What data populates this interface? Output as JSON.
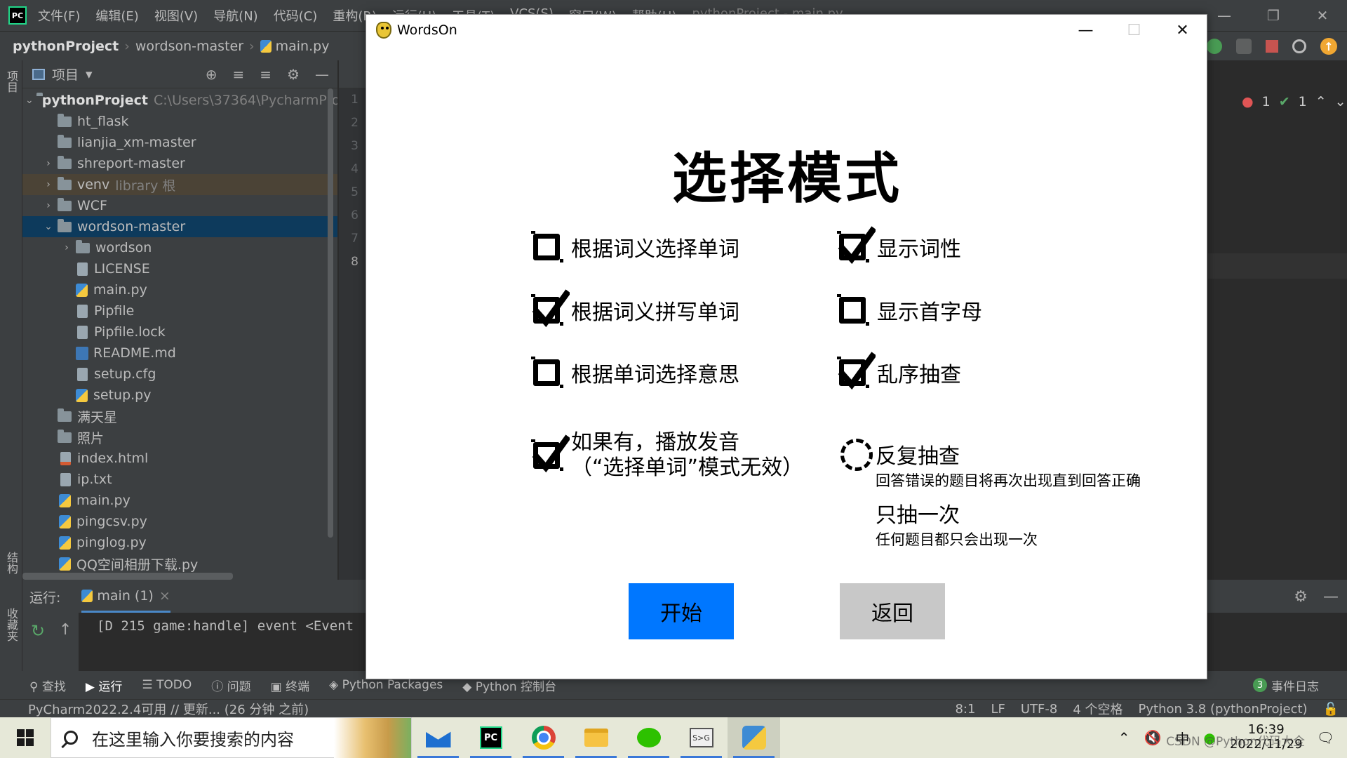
{
  "ide": {
    "logo": "PC",
    "menu": [
      "文件(F)",
      "编辑(E)",
      "视图(V)",
      "导航(N)",
      "代码(C)",
      "重构(R)",
      "运行(U)",
      "工具(T)",
      "VCS(S)",
      "窗口(W)",
      "帮助(H)",
      "pythonProject - main.py"
    ],
    "breadcrumb": [
      "pythonProject",
      "wordson-master",
      "main.py"
    ],
    "left_stripe": {
      "project": "项目",
      "structure": "结构",
      "favorites": "收藏夹"
    },
    "project_panel": {
      "title": "项目",
      "root_name": "pythonProject",
      "root_path": "C:\\Users\\37364\\PycharmProj",
      "items": [
        {
          "label": "ht_flask",
          "type": "folder"
        },
        {
          "label": "lianjia_xm-master",
          "type": "folder"
        },
        {
          "label": "shreport-master",
          "type": "folder"
        },
        {
          "label": "venv",
          "type": "folder",
          "extra": "library 根"
        },
        {
          "label": "WCF",
          "type": "folder"
        },
        {
          "label": "wordson-master",
          "type": "folder"
        },
        {
          "label": "wordson",
          "type": "folder"
        },
        {
          "label": "LICENSE",
          "type": "file"
        },
        {
          "label": "main.py",
          "type": "python"
        },
        {
          "label": "Pipfile",
          "type": "file"
        },
        {
          "label": "Pipfile.lock",
          "type": "file"
        },
        {
          "label": "README.md",
          "type": "markdown"
        },
        {
          "label": "setup.cfg",
          "type": "file"
        },
        {
          "label": "setup.py",
          "type": "python"
        },
        {
          "label": "满天星",
          "type": "folder"
        },
        {
          "label": "照片",
          "type": "folder"
        },
        {
          "label": "index.html",
          "type": "html"
        },
        {
          "label": "ip.txt",
          "type": "file"
        },
        {
          "label": "main.py",
          "type": "python"
        },
        {
          "label": "pingcsv.py",
          "type": "python"
        },
        {
          "label": "pinglog.py",
          "type": "python"
        },
        {
          "label": "QQ空间相册下载.py",
          "type": "python"
        }
      ]
    },
    "line_numbers": [
      "1",
      "2",
      "3",
      "4",
      "5",
      "6",
      "7",
      "8"
    ],
    "inspection": {
      "errors": "1",
      "warnings": "1"
    },
    "run_panel": {
      "label": "运行:",
      "tab": "main (1)",
      "console": "[D 215 game:handle] event <Event"
    },
    "tool_tabs": [
      "查找",
      "运行",
      "TODO",
      "问题",
      "终端",
      "Python Packages",
      "Python 控制台"
    ],
    "event_log": {
      "count": "3",
      "label": "事件日志"
    },
    "status": {
      "message": "PyCharm2022.2.4可用 // 更新... (26 分钟 之前)",
      "position": "8:1",
      "line_sep": "LF",
      "encoding": "UTF-8",
      "indent": "4 个空格",
      "interpreter": "Python 3.8 (pythonProject)"
    }
  },
  "game_window": {
    "title": "WordsOn",
    "heading": "选择模式",
    "options": [
      {
        "label": "根据词义选择单词",
        "checked": false
      },
      {
        "label": "根据词义拼写单词",
        "checked": true
      },
      {
        "label": "根据单词选择意思",
        "checked": false
      },
      {
        "label_line1": "如果有，播放发音",
        "label_line2": "（“选择单词”模式无效）",
        "checked": true
      },
      {
        "label": "显示词性",
        "checked": true
      },
      {
        "label": "显示首字母",
        "checked": false
      },
      {
        "label": "乱序抽查",
        "checked": true
      }
    ],
    "radios": [
      {
        "title": "反复抽查",
        "sub": "回答错误的题目将再次出现直到回答正确",
        "selected": true
      },
      {
        "title": "只抽一次",
        "sub": "任何题目都只会出现一次",
        "selected": false
      }
    ],
    "start_button": "开始",
    "back_button": "返回",
    "colors": {
      "start": "#0077ff",
      "back": "#c8c8c8"
    }
  },
  "taskbar": {
    "search_placeholder": "在这里输入你要搜索的内容",
    "time": "16:39",
    "date": "2022/11/29",
    "ime": "中",
    "watermark": "CSDN @Python代码大全"
  }
}
